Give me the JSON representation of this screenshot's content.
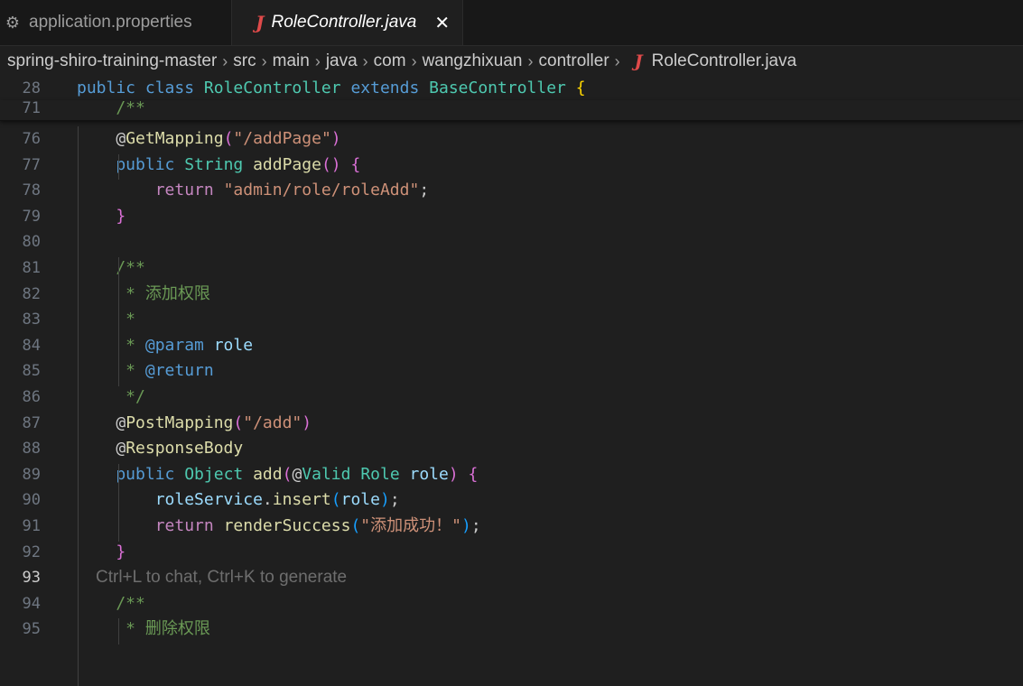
{
  "tabs": [
    {
      "label": "application.properties",
      "icon": "gear-icon"
    },
    {
      "label": "RoleController.java",
      "icon": "java-icon",
      "close": "✕"
    }
  ],
  "breadcrumb": [
    "spring-shiro-training-master",
    "src",
    "main",
    "java",
    "com",
    "wangzhixuan",
    "controller",
    "RoleController.java"
  ],
  "sticky": [
    {
      "num": "28",
      "tokens": [
        [
          "kw",
          "public "
        ],
        [
          "kw",
          "class "
        ],
        [
          "type",
          "RoleController "
        ],
        [
          "kw",
          "extends "
        ],
        [
          "type",
          "BaseController "
        ],
        [
          "br1",
          "{"
        ]
      ]
    },
    {
      "num": "71",
      "tokens": [
        [
          "cm",
          "    /**"
        ]
      ]
    }
  ],
  "lines": [
    {
      "num": "76",
      "tokens": [
        [
          "at",
          "    @"
        ],
        [
          "ann",
          "GetMapping"
        ],
        [
          "br2",
          "("
        ],
        [
          "str",
          "\"/addPage\""
        ],
        [
          "br2",
          ")"
        ]
      ]
    },
    {
      "num": "77",
      "tokens": [
        [
          "kw",
          "    public "
        ],
        [
          "type",
          "String "
        ],
        [
          "fn",
          "addPage"
        ],
        [
          "br2",
          "() {"
        ]
      ]
    },
    {
      "num": "78",
      "tokens": [
        [
          "ctl",
          "        return "
        ],
        [
          "str",
          "\"admin/role/roleAdd\""
        ],
        [
          "plain",
          ";"
        ]
      ]
    },
    {
      "num": "79",
      "tokens": [
        [
          "br2",
          "    }"
        ]
      ]
    },
    {
      "num": "80",
      "tokens": []
    },
    {
      "num": "81",
      "tokens": [
        [
          "cm",
          "    /**"
        ]
      ]
    },
    {
      "num": "82",
      "tokens": [
        [
          "cm",
          "     * 添加权限"
        ]
      ]
    },
    {
      "num": "83",
      "tokens": [
        [
          "cm",
          "     *"
        ]
      ]
    },
    {
      "num": "84",
      "tokens": [
        [
          "cm",
          "     * "
        ],
        [
          "cmtag",
          "@param "
        ],
        [
          "cmvar",
          "role"
        ]
      ]
    },
    {
      "num": "85",
      "tokens": [
        [
          "cm",
          "     * "
        ],
        [
          "cmtag",
          "@return"
        ]
      ]
    },
    {
      "num": "86",
      "tokens": [
        [
          "cm",
          "     */"
        ]
      ]
    },
    {
      "num": "87",
      "tokens": [
        [
          "at",
          "    @"
        ],
        [
          "ann",
          "PostMapping"
        ],
        [
          "br2",
          "("
        ],
        [
          "str",
          "\"/add\""
        ],
        [
          "br2",
          ")"
        ]
      ]
    },
    {
      "num": "88",
      "tokens": [
        [
          "at",
          "    @"
        ],
        [
          "ann",
          "ResponseBody"
        ]
      ]
    },
    {
      "num": "89",
      "tokens": [
        [
          "kw",
          "    public "
        ],
        [
          "type",
          "Object "
        ],
        [
          "fn",
          "add"
        ],
        [
          "br2",
          "("
        ],
        [
          "at",
          "@"
        ],
        [
          "type",
          "Valid "
        ],
        [
          "type",
          "Role "
        ],
        [
          "var",
          "role"
        ],
        [
          "br2",
          ") {"
        ]
      ]
    },
    {
      "num": "90",
      "tokens": [
        [
          "var",
          "        roleService"
        ],
        [
          "plain",
          "."
        ],
        [
          "fn",
          "insert"
        ],
        [
          "br3",
          "("
        ],
        [
          "var",
          "role"
        ],
        [
          "br3",
          ")"
        ],
        [
          "plain",
          ";"
        ]
      ]
    },
    {
      "num": "91",
      "tokens": [
        [
          "ctl",
          "        return "
        ],
        [
          "fn",
          "renderSuccess"
        ],
        [
          "br3",
          "("
        ],
        [
          "str",
          "\"添加成功！\""
        ],
        [
          "br3",
          ")"
        ],
        [
          "plain",
          ";"
        ]
      ]
    },
    {
      "num": "92",
      "tokens": [
        [
          "br2",
          "    }"
        ]
      ]
    },
    {
      "num": "93",
      "tokens": [],
      "current": true,
      "hint": "Ctrl+L to chat, Ctrl+K to generate"
    },
    {
      "num": "94",
      "tokens": [
        [
          "cm",
          "    /**"
        ]
      ]
    },
    {
      "num": "95",
      "tokens": [
        [
          "cm",
          "     * 删除权限"
        ]
      ]
    }
  ]
}
